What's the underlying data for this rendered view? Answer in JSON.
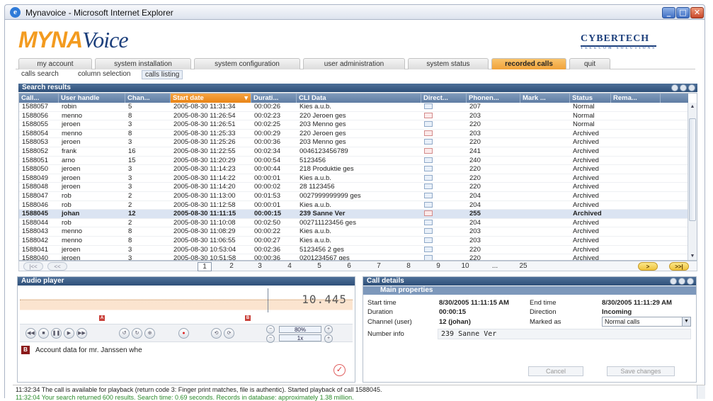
{
  "window": {
    "title": "Mynavoice - Microsoft Internet Explorer",
    "min": "_",
    "max": "□",
    "close": "✕",
    "ie_glyph": "e"
  },
  "logo": {
    "part1": "MYNA",
    "part2": "Voice"
  },
  "brand": {
    "name": "CYBERTECH",
    "tagline": "TELECOM SOLUTIONS"
  },
  "tabs": [
    "my account",
    "system installation",
    "system configuration",
    "user administration",
    "system status",
    "recorded calls",
    "quit"
  ],
  "active_tab": "recorded calls",
  "subtabs": [
    "calls search",
    "column selection",
    "calls listing"
  ],
  "active_subtab": "calls listing",
  "search_results": {
    "title": "Search results",
    "columns": [
      "Call...",
      "User handle",
      "Chan...",
      "Start date",
      "Durati...",
      "CLI Data",
      "Direct...",
      "Phonen...",
      "Mark ...",
      "Status",
      "Rema..."
    ],
    "sorted_column": "Start date",
    "rows": [
      {
        "call": "1588057",
        "user": "robin",
        "chan": "5",
        "start": "2005-08-30 11:31:34",
        "dur": "00:00:26",
        "cli": "Kies a.u.b.",
        "dir": "out",
        "phone": "207",
        "mark": "",
        "status": "Normal"
      },
      {
        "call": "1588056",
        "user": "menno",
        "chan": "8",
        "start": "2005-08-30 11:26:54",
        "dur": "00:02:23",
        "cli": "220 Jeroen ges",
        "dir": "in",
        "phone": "203",
        "mark": "",
        "status": "Normal"
      },
      {
        "call": "1588055",
        "user": "jeroen",
        "chan": "3",
        "start": "2005-08-30 11:26:51",
        "dur": "00:02:25",
        "cli": "203 Menno ges",
        "dir": "out",
        "phone": "220",
        "mark": "",
        "status": "Normal"
      },
      {
        "call": "1588054",
        "user": "menno",
        "chan": "8",
        "start": "2005-08-30 11:25:33",
        "dur": "00:00:29",
        "cli": "220 Jeroen ges",
        "dir": "in",
        "phone": "203",
        "mark": "",
        "status": "Archived"
      },
      {
        "call": "1588053",
        "user": "jeroen",
        "chan": "3",
        "start": "2005-08-30 11:25:26",
        "dur": "00:00:36",
        "cli": "203 Menno ges",
        "dir": "out",
        "phone": "220",
        "mark": "",
        "status": "Archived"
      },
      {
        "call": "1588052",
        "user": "frank",
        "chan": "16",
        "start": "2005-08-30 11:22:55",
        "dur": "00:02:34",
        "cli": "0046123456789",
        "dir": "in",
        "phone": "241",
        "mark": "",
        "status": "Archived"
      },
      {
        "call": "1588051",
        "user": "arno",
        "chan": "15",
        "start": "2005-08-30 11:20:29",
        "dur": "00:00:54",
        "cli": "5123456",
        "dir": "out",
        "phone": "240",
        "mark": "",
        "status": "Archived"
      },
      {
        "call": "1588050",
        "user": "jeroen",
        "chan": "3",
        "start": "2005-08-30 11:14:23",
        "dur": "00:00:44",
        "cli": "218 Produktie ges",
        "dir": "out",
        "phone": "220",
        "mark": "",
        "status": "Archived"
      },
      {
        "call": "1588049",
        "user": "jeroen",
        "chan": "3",
        "start": "2005-08-30 11:14:22",
        "dur": "00:00:01",
        "cli": "Kies a.u.b.",
        "dir": "out",
        "phone": "220",
        "mark": "",
        "status": "Archived"
      },
      {
        "call": "1588048",
        "user": "jeroen",
        "chan": "3",
        "start": "2005-08-30 11:14:20",
        "dur": "00:00:02",
        "cli": "28 1123456",
        "dir": "out",
        "phone": "220",
        "mark": "",
        "status": "Archived"
      },
      {
        "call": "1588047",
        "user": "rob",
        "chan": "2",
        "start": "2005-08-30 11:13:00",
        "dur": "00:01:53",
        "cli": "0027999999999 ges",
        "dir": "out",
        "phone": "204",
        "mark": "",
        "status": "Archived"
      },
      {
        "call": "1588046",
        "user": "rob",
        "chan": "2",
        "start": "2005-08-30 11:12:58",
        "dur": "00:00:01",
        "cli": "Kies a.u.b.",
        "dir": "out",
        "phone": "204",
        "mark": "",
        "status": "Archived"
      },
      {
        "call": "1588045",
        "user": "johan",
        "chan": "12",
        "start": "2005-08-30 11:11:15",
        "dur": "00:00:15",
        "cli": "239 Sanne Ver",
        "dir": "in",
        "phone": "255",
        "mark": "",
        "status": "Archived"
      },
      {
        "call": "1588044",
        "user": "rob",
        "chan": "2",
        "start": "2005-08-30 11:10:08",
        "dur": "00:02:50",
        "cli": "002711123456   ges",
        "dir": "out",
        "phone": "204",
        "mark": "",
        "status": "Archived"
      },
      {
        "call": "1588043",
        "user": "menno",
        "chan": "8",
        "start": "2005-08-30 11:08:29",
        "dur": "00:00:22",
        "cli": "Kies a.u.b.",
        "dir": "out",
        "phone": "203",
        "mark": "",
        "status": "Archived"
      },
      {
        "call": "1588042",
        "user": "menno",
        "chan": "8",
        "start": "2005-08-30 11:06:55",
        "dur": "00:00:27",
        "cli": "Kies a.u.b.",
        "dir": "out",
        "phone": "203",
        "mark": "",
        "status": "Archived"
      },
      {
        "call": "1588041",
        "user": "jeroen",
        "chan": "3",
        "start": "2005-08-30 10:53:04",
        "dur": "00:02:36",
        "cli": "5123456 2 ges",
        "dir": "out",
        "phone": "220",
        "mark": "",
        "status": "Archived"
      },
      {
        "call": "1588040",
        "user": "jeroen",
        "chan": "3",
        "start": "2005-08-30 10:51:58",
        "dur": "00:00:36",
        "cli": "0201234567 ges",
        "dir": "out",
        "phone": "220",
        "mark": "",
        "status": "Archived"
      }
    ],
    "selected_call": "1588045"
  },
  "pager": {
    "first": "|<<",
    "prev": "<<",
    "pages": [
      "1",
      "2",
      "3",
      "4",
      "5",
      "6",
      "7",
      "8",
      "9",
      "10",
      "...",
      "25"
    ],
    "current": "1",
    "next": ">",
    "last": ">>|"
  },
  "audio": {
    "title": "Audio player",
    "timer": "10.445",
    "marker_a": "A",
    "marker_b": "B",
    "volume": "80%",
    "speed": "1x",
    "note_badge": "B",
    "note_text": "Account data for mr. Janssen whe",
    "controls": [
      "◀◀",
      "■",
      "❚❚",
      "▶",
      "▶▶"
    ],
    "controls2": [
      "↺",
      "↻",
      "⊕"
    ],
    "rec": "●",
    "controls3": [
      "⟲",
      "⟳"
    ],
    "check": "✓"
  },
  "call_details": {
    "title": "Call details",
    "section": "Main properties",
    "start_time_label": "Start time",
    "start_time": "8/30/2005 11:11:15 AM",
    "end_time_label": "End time",
    "end_time": "8/30/2005 11:11:29 AM",
    "duration_label": "Duration",
    "duration": "00:00:15",
    "direction_label": "Direction",
    "direction": "Incoming",
    "channel_label": "Channel (user)",
    "channel": "12 (johan)",
    "marked_label": "Marked as",
    "marked_value": "Normal calls",
    "number_label": "Number info",
    "number_value": "239 Sanne Ver",
    "cancel": "Cancel",
    "save": "Save changes"
  },
  "log": {
    "line1": "11:32:34   The call is available for playback (return code 3: Finger print matches, file is authentic). Started playback of call 1588045.",
    "line2": "11:32:04   Your search returned 600 results. Search time: 0.69 seconds. Records in database: approximately 1.38 million."
  },
  "colors": {
    "accent": "#f0a23a",
    "header": "#2f5079",
    "brand": "#1c3f7c"
  }
}
